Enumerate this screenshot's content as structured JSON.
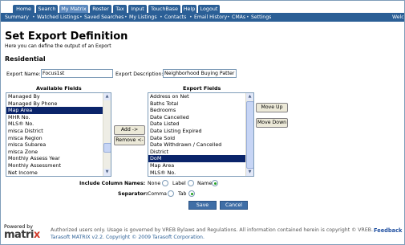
{
  "topnav": {
    "tabs": [
      "Home",
      "Search",
      "My Matrix",
      "Roster",
      "Tax",
      "Input",
      "TouchBase",
      "Help",
      "Logout"
    ],
    "active": "My Matrix"
  },
  "subnav": {
    "links": [
      "Summary",
      "Watched Listings",
      "Saved Searches",
      "My Listings",
      "Contacts",
      "Email History",
      "CMAs",
      "Settings"
    ],
    "welcome": "Welc"
  },
  "page": {
    "title": "Set Export Definition",
    "subtitle": "Here you can define the output of an Export",
    "section": "Residential"
  },
  "form": {
    "export_name_label": "Export Name:",
    "export_name_value": "Focus1st",
    "export_description_label": "Export Description:",
    "export_description_value": "Neighborhood Buying Patter"
  },
  "available_fields": {
    "header": "Available Fields",
    "items": [
      "Managed By",
      "Managed By Phone",
      "Map Area",
      "MHR No.",
      "MLS® No.",
      "mlsca District",
      "mlsca Region",
      "mlsca Subarea",
      "mlsca Zone",
      "Monthly Assess Year",
      "Monthly Assessment",
      "Net Income"
    ],
    "selected": "Map Area"
  },
  "export_fields": {
    "header": "Export Fields",
    "items": [
      "Address on Net",
      "Baths Total",
      "Bedrooms",
      "Date Cancelled",
      "Date Listed",
      "Date Listing Expired",
      "Date Sold",
      "Date Withdrawn / Cancelled",
      "District",
      "DoM",
      "Map Area",
      "MLS® No."
    ],
    "selected": "DoM"
  },
  "buttons": {
    "add": "Add ->",
    "remove": "Remove <-",
    "move_up": "Move Up",
    "move_down": "Move Down",
    "save": "Save",
    "cancel": "Cancel"
  },
  "options": {
    "column_names_label": "Include Column Names:",
    "column_names_choices": [
      "None",
      "Label",
      "Name"
    ],
    "column_names_selected": "Name",
    "separator_label": "Separator:",
    "separator_choices": [
      "Comma",
      "Tab"
    ],
    "separator_selected": "Tab"
  },
  "footer": {
    "powered_by": "Powered by",
    "logo_text_a": "matri",
    "logo_text_b": "x",
    "line1": "Authorized users only.  Usage is governed by VREB Bylaws and Regulations.  All information contained herein is copyright © VREB.",
    "line2": "Tarasoft MATRIX v2.2. Copyright © 2009 Tarasoft Corporation.",
    "feedback": "Feedback"
  },
  "colors": {
    "nav_blue": "#2b5f96",
    "active_tab": "#5b88bd",
    "selection": "#0a246a",
    "button_blue": "#3f6ea6"
  }
}
